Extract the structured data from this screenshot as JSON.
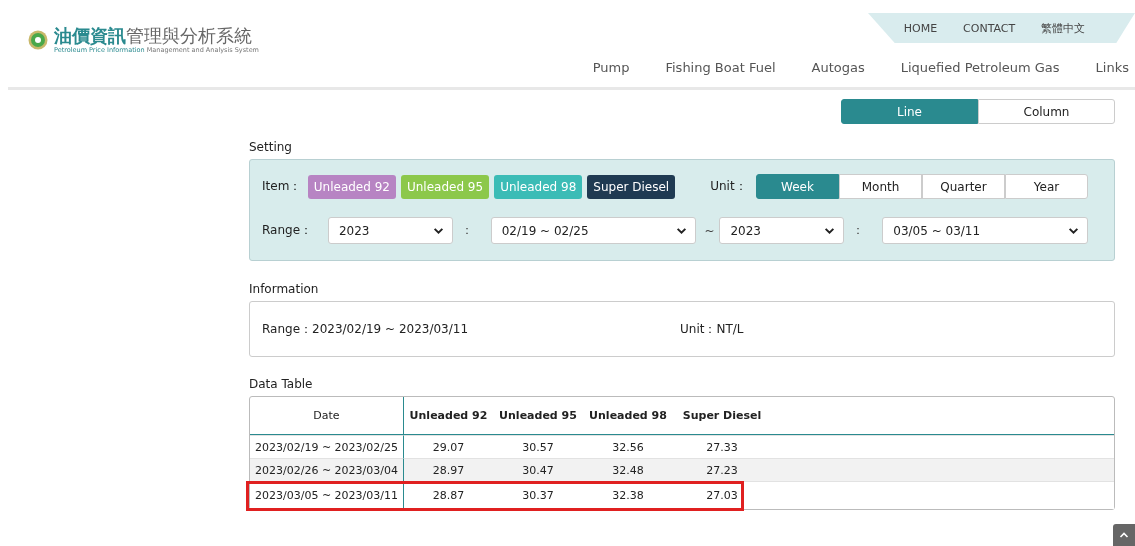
{
  "header": {
    "logo_title_bold": "油價資訊",
    "logo_title_rest": "管理與分析系統",
    "logo_subtitle_bold": "Petroleum Price Information",
    "logo_subtitle_rest": " Management and Analysis System",
    "top_links": [
      "HOME",
      "CONTACT",
      "繁體中文"
    ],
    "nav": [
      "Pump",
      "Fishing Boat Fuel",
      "Autogas",
      "Liquefied Petroleum Gas",
      "Links"
    ]
  },
  "view_toggle": [
    {
      "label": "Line",
      "selected": true
    },
    {
      "label": "Column",
      "selected": false
    }
  ],
  "setting": {
    "title": "Setting",
    "item_label": "Item：",
    "items": [
      {
        "label": "Unleaded 92",
        "color": "#b784c3"
      },
      {
        "label": "Unleaded 95",
        "color": "#8cc84b"
      },
      {
        "label": "Unleaded 98",
        "color": "#3bbcb6"
      },
      {
        "label": "Super Diesel",
        "color": "#1f3a52"
      }
    ],
    "unit_label": "Unit：",
    "units": [
      {
        "label": "Week",
        "selected": true
      },
      {
        "label": "Month",
        "selected": false
      },
      {
        "label": "Quarter",
        "selected": false
      },
      {
        "label": "Year",
        "selected": false
      }
    ],
    "range_label": "Range：",
    "range": {
      "start_year": "2023",
      "start_week": "02/19 ~ 02/25",
      "end_year": "2023",
      "end_week": "03/05 ~ 03/11",
      "colon": "：",
      "tilde": "~"
    }
  },
  "information": {
    "title": "Information",
    "range": "Range：2023/02/19 ~ 2023/03/11",
    "unit": "Unit：NT/L"
  },
  "data_table": {
    "title": "Data Table",
    "columns": [
      "Date",
      "Unleaded 92",
      "Unleaded 95",
      "Unleaded 98",
      "Super Diesel"
    ],
    "rows": [
      {
        "cells": [
          "2023/02/19 ~ 2023/02/25",
          "29.07",
          "30.57",
          "32.56",
          "27.33"
        ],
        "highlighted": false
      },
      {
        "cells": [
          "2023/02/26 ~ 2023/03/04",
          "28.97",
          "30.47",
          "32.48",
          "27.23"
        ],
        "highlighted": false
      },
      {
        "cells": [
          "2023/03/05 ~ 2023/03/11",
          "28.87",
          "30.37",
          "32.38",
          "27.03"
        ],
        "highlighted": true
      }
    ]
  }
}
